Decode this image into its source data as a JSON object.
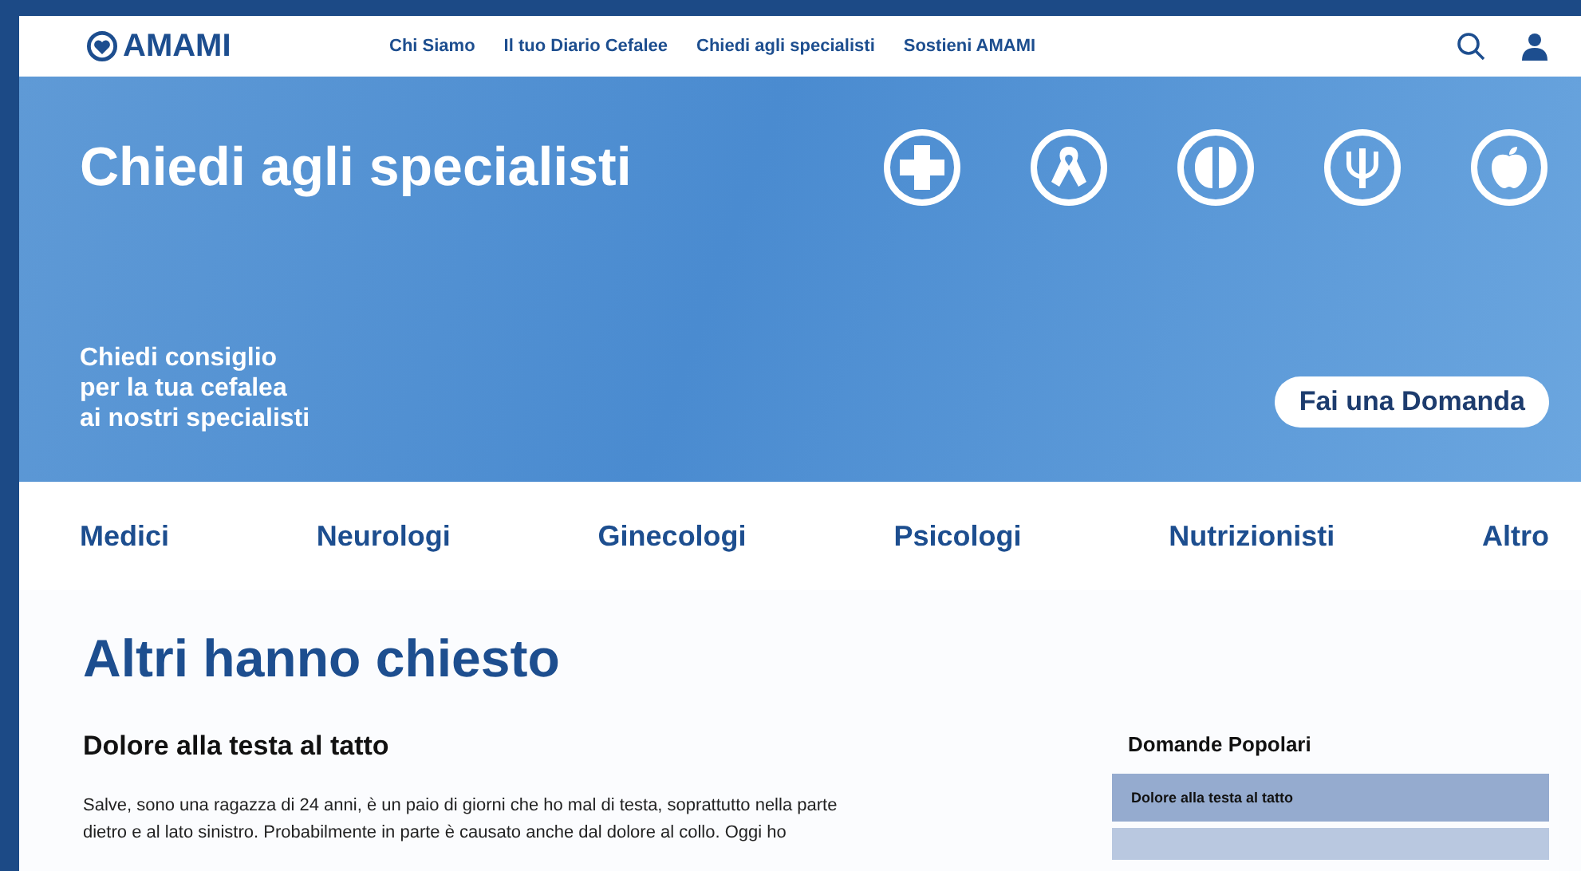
{
  "header": {
    "logo": "AMAMI",
    "nav": [
      {
        "label": "Chi Siamo"
      },
      {
        "label": "Il tuo Diario Cefalee"
      },
      {
        "label": "Chiedi agli specialisti"
      },
      {
        "label": "Sostieni AMAMI"
      }
    ]
  },
  "hero": {
    "title": "Chiedi agli specialisti",
    "subtitle": [
      "Chiedi consiglio",
      "per la tua cefalea",
      "ai nostri specialisti"
    ],
    "specialties": [
      {
        "kind": "cross"
      },
      {
        "kind": "ribbon"
      },
      {
        "kind": "brain"
      },
      {
        "kind": "psi"
      },
      {
        "kind": "apple"
      }
    ],
    "button": "Fai una Domanda"
  },
  "categories": [
    {
      "label": "Medici"
    },
    {
      "label": "Neurologi"
    },
    {
      "label": "Ginecologi"
    },
    {
      "label": "Psicologi"
    },
    {
      "label": "Nutrizionisti"
    },
    {
      "label": "Altro"
    }
  ],
  "section_title": "Altri hanno chiesto",
  "question": {
    "title": "Dolore alla testa al tatto",
    "body": [
      "Salve, sono una ragazza di 24 anni, è un paio di giorni che ho mal di testa, soprattutto nella parte",
      "dietro e al lato sinistro. Probabilmente in parte è causato anche dal dolore al collo. Oggi ho"
    ]
  },
  "sidebar": {
    "title": "Domande Popolari",
    "items": [
      {
        "label": "Dolore alla testa al tatto"
      }
    ]
  }
}
